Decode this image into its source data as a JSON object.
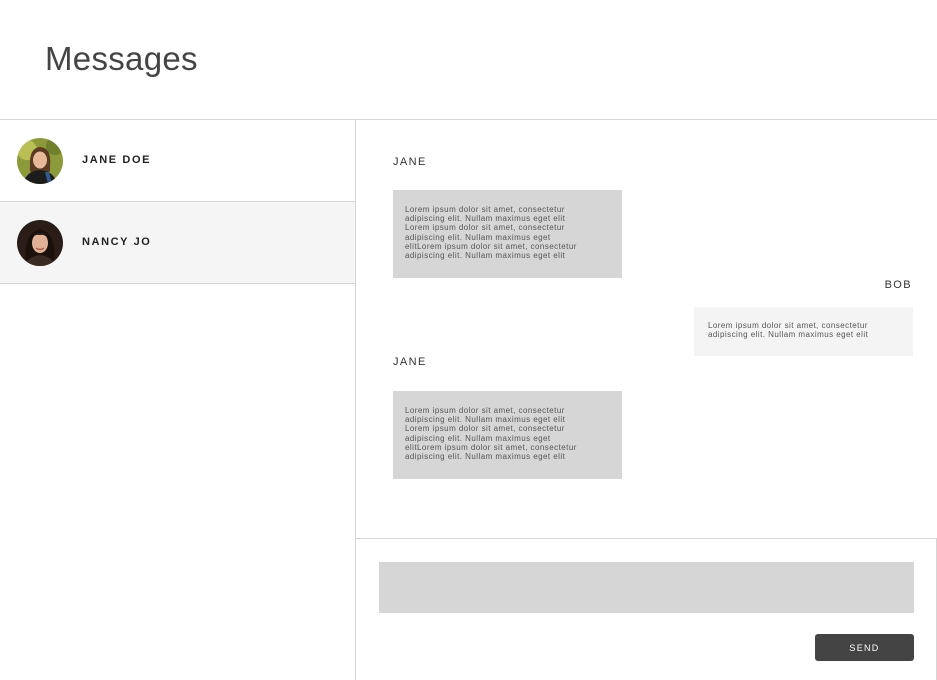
{
  "header": {
    "title": "Messages"
  },
  "sidebar": {
    "contacts": [
      {
        "name": "JANE DOE",
        "avatar_icon": "avatar-jane-doe",
        "active": false
      },
      {
        "name": "NANCY JO",
        "avatar_icon": "avatar-nancy-jo",
        "active": true
      }
    ]
  },
  "conversation": {
    "messages": [
      {
        "sender": "JANE",
        "direction": "incoming",
        "lines": [
          "Lorem ipsum dolor sit amet, consectetur",
          "adipiscing elit. Nullam maximus eget elit",
          "Lorem ipsum dolor sit amet, consectetur",
          "adipiscing elit. Nullam maximus eget",
          "elitLorem ipsum dolor sit amet, consectetur",
          "adipiscing elit. Nullam maximus eget elit"
        ]
      },
      {
        "sender": "BOB",
        "direction": "outgoing",
        "lines": [
          "Lorem ipsum dolor sit amet, consectetur",
          "adipiscing elit. Nullam maximus eget elit"
        ]
      },
      {
        "sender": "JANE",
        "direction": "incoming",
        "lines": [
          "Lorem ipsum dolor sit amet, consectetur",
          "adipiscing elit. Nullam maximus eget elit",
          "Lorem ipsum dolor sit amet, consectetur",
          "adipiscing elit. Nullam maximus eget",
          "elitLorem ipsum dolor sit amet, consectetur",
          "adipiscing elit. Nullam maximus eget elit"
        ]
      }
    ]
  },
  "composer": {
    "input_value": "",
    "input_placeholder": "",
    "send_label": "SEND"
  },
  "colors": {
    "incoming_bubble": "#d6d6d6",
    "outgoing_bubble": "#f4f4f4",
    "send_button": "#444444",
    "active_contact": "#f5f5f5",
    "divider": "#d6d6d6"
  }
}
